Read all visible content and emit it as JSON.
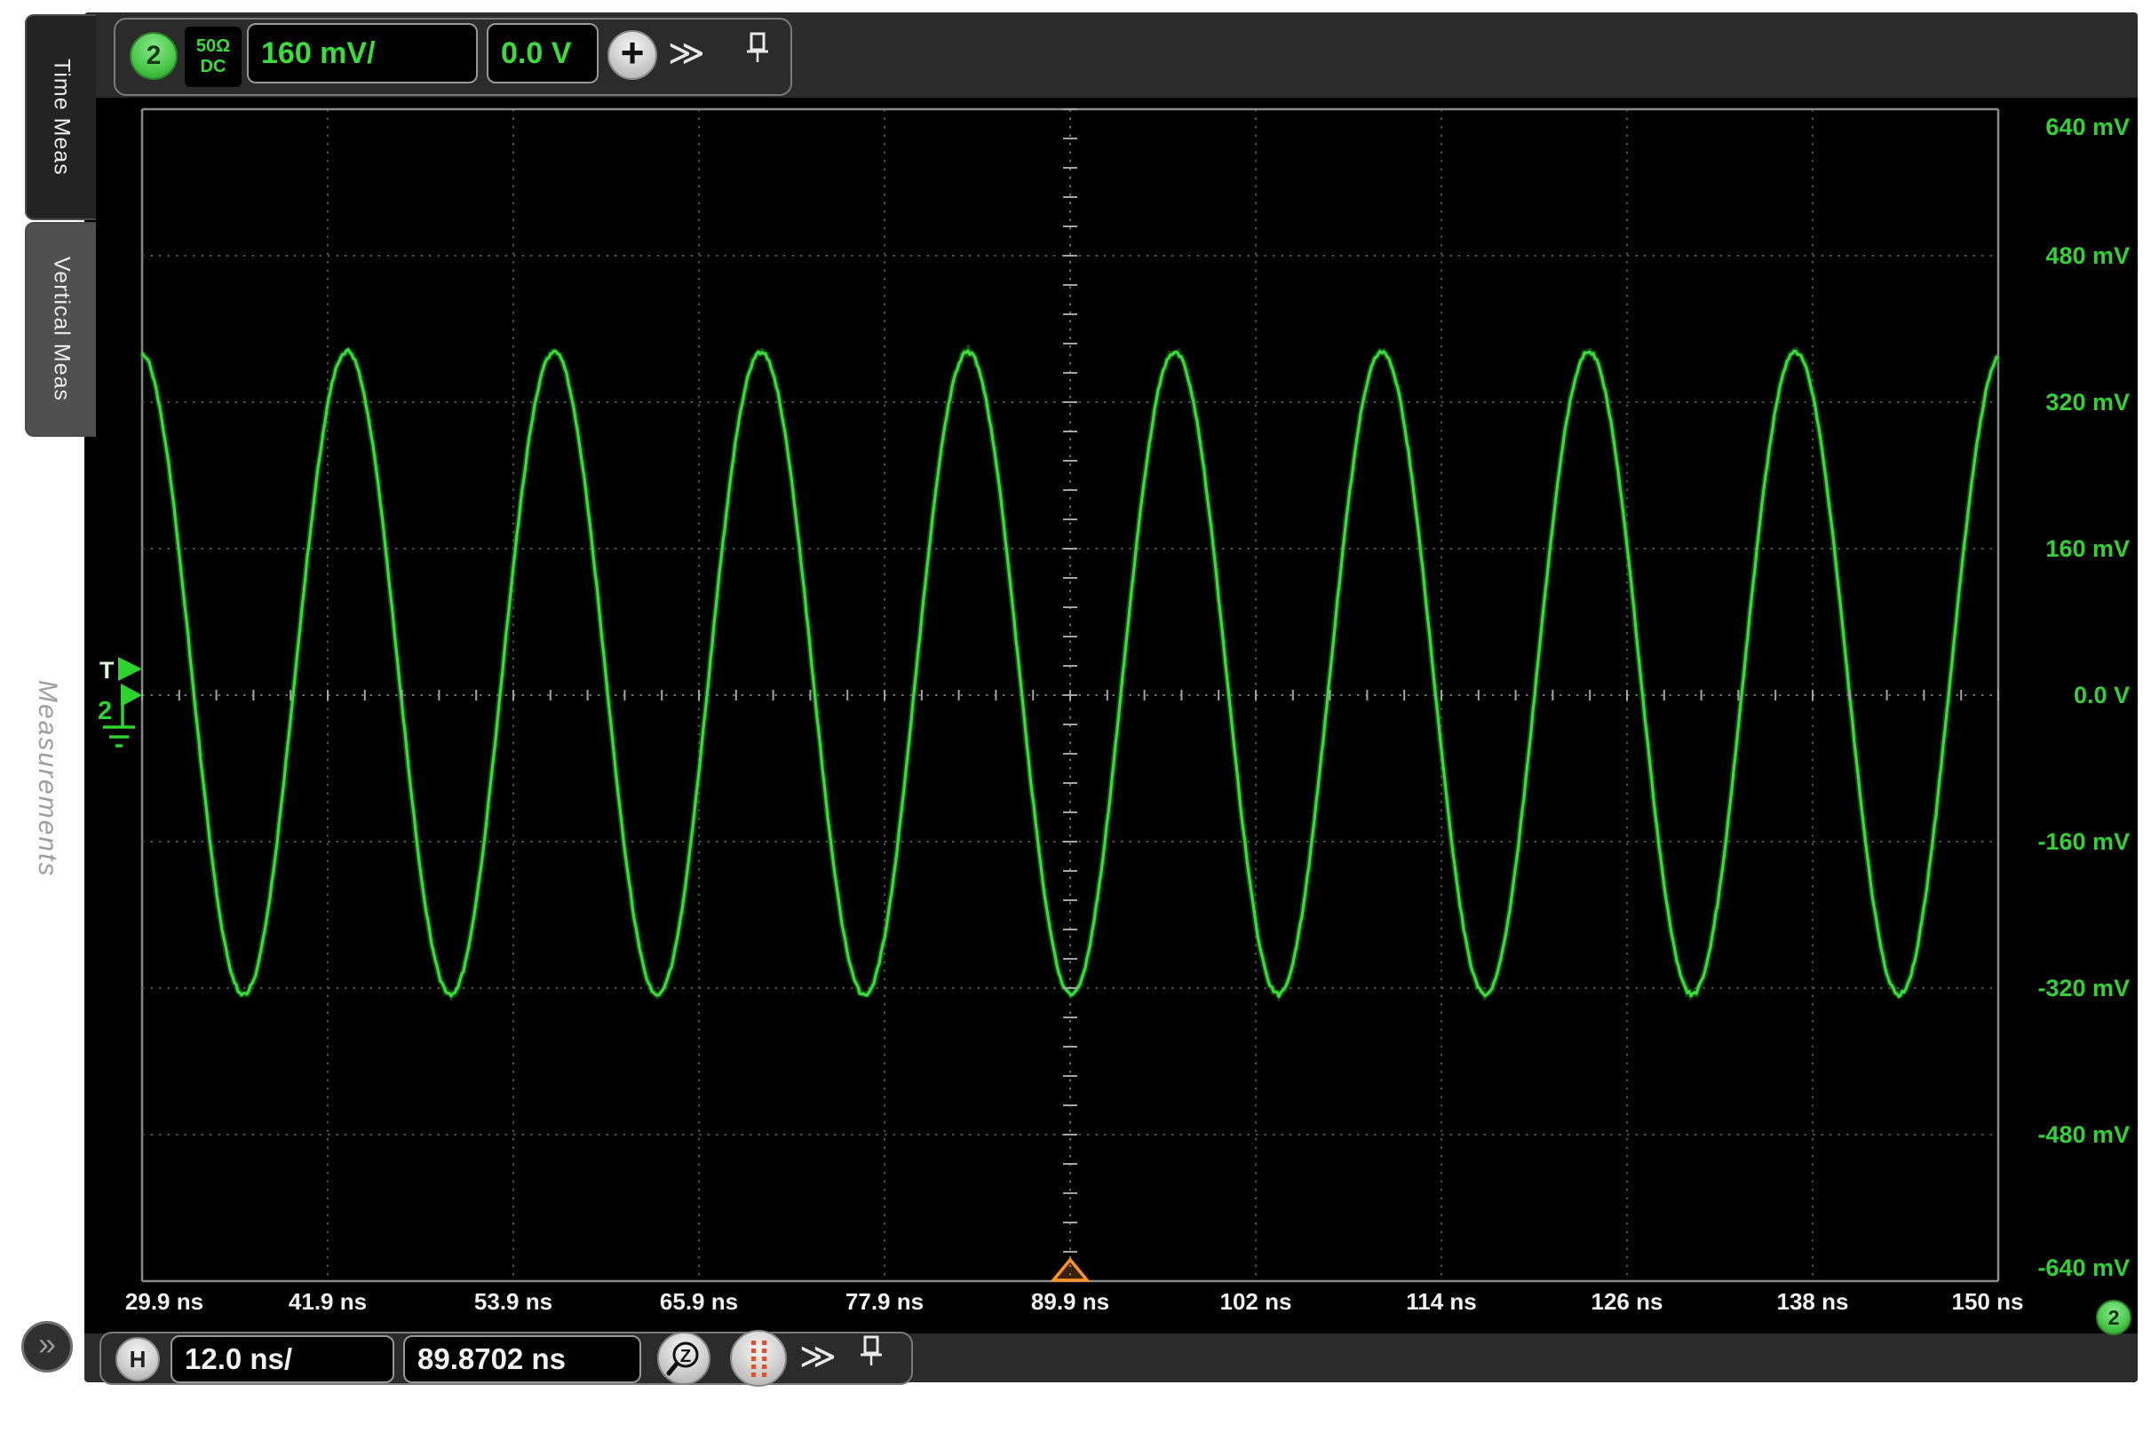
{
  "sidebar": {
    "tabs": [
      {
        "label": "Time Meas"
      },
      {
        "label": "Vertical Meas"
      }
    ],
    "watermark": "Measurements",
    "expand_label": "»"
  },
  "channel_toolbar": {
    "channel_badge": "2",
    "coupling_impedance": "50Ω",
    "coupling_mode": "DC",
    "scale_value": "160 mV/",
    "offset_value": "0.0 V",
    "add_label": "+",
    "more_label": "≫"
  },
  "horizontal_toolbar": {
    "h_badge": "H",
    "timebase_value": "12.0 ns/",
    "delay_value": "89.8702 ns",
    "zoom_badge": "Z",
    "more_label": "≫"
  },
  "plot": {
    "trigger_marker_label": "T",
    "channel_marker_label": "2",
    "right_channel_badge": "2"
  },
  "chart_data": {
    "type": "line",
    "title": "Oscilloscope channel 2 sine waveform",
    "x_unit": "ns",
    "y_unit": "mV",
    "x_range": [
      29.9,
      150.0
    ],
    "y_range": [
      -640,
      640
    ],
    "x_divisions": 10,
    "y_divisions": 8,
    "time_per_division_ns": 12.0,
    "volts_per_division_mV": 160,
    "x_tick_labels": [
      "29.9 ns",
      "41.9 ns",
      "53.9 ns",
      "65.9 ns",
      "77.9 ns",
      "89.9 ns",
      "102 ns",
      "114 ns",
      "126 ns",
      "138 ns",
      "150 ns"
    ],
    "y_tick_labels": [
      "640 mV",
      "480 mV",
      "320 mV",
      "160 mV",
      "0.0 V",
      "-160 mV",
      "-320 mV",
      "-480 mV",
      "-640 mV"
    ],
    "grid": true,
    "legend": "none",
    "waveform": {
      "shape": "sine",
      "amplitude_mV": 351,
      "offset_mV": 24,
      "period_ns": 13.39,
      "peak_time_ns": 43.16,
      "noise_mV": 4
    },
    "trigger": {
      "level_mV": 29,
      "time_ns": 89.8702
    },
    "line_color": "#3bdb3b"
  }
}
